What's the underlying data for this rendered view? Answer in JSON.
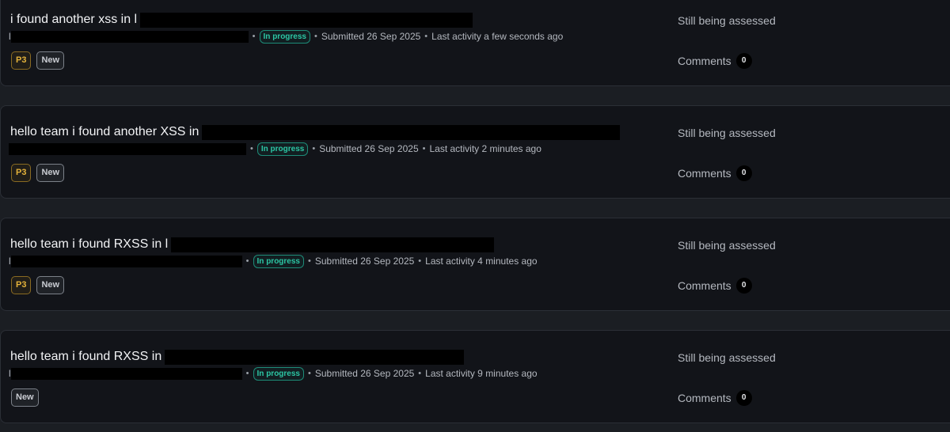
{
  "reports": [
    {
      "title": "i found another xss in l",
      "title_tail": "",
      "title_redact_width": 420,
      "meta_prefix": "l",
      "meta_redact_width": 300,
      "status": "In progress",
      "submitted": "Submitted 26 Sep 2025",
      "last_activity": "Last activity a few seconds ago",
      "priority": "P3",
      "state_tag": "New",
      "assessment": "Still being assessed",
      "comments_label": "Comments",
      "comments_count": "0"
    },
    {
      "title": "hello team i found another XSS in",
      "title_tail": "",
      "title_redact_width": 528,
      "meta_prefix": "",
      "meta_redact_width": 298,
      "status": "In progress",
      "submitted": "Submitted 26 Sep 2025",
      "last_activity": "Last activity 2 minutes ago",
      "priority": "P3",
      "state_tag": "New",
      "assessment": "Still being assessed",
      "comments_label": "Comments",
      "comments_count": "0"
    },
    {
      "title": "hello team i found RXSS in l",
      "title_tail": "",
      "title_redact_width": 408,
      "meta_prefix": "l",
      "meta_redact_width": 290,
      "status": "In progress",
      "submitted": "Submitted 26 Sep 2025",
      "last_activity": "Last activity 4 minutes ago",
      "priority": "P3",
      "state_tag": "New",
      "assessment": "Still being assessed",
      "comments_label": "Comments",
      "comments_count": "0"
    },
    {
      "title": "hello team i found RXSS in",
      "title_tail": "",
      "title_redact_width": 378,
      "meta_prefix": "l",
      "meta_redact_width": 290,
      "status": "In progress",
      "submitted": "Submitted 26 Sep 2025",
      "last_activity": "Last activity 9 minutes ago",
      "priority": null,
      "state_tag": "New",
      "assessment": "Still being assessed",
      "comments_label": "Comments",
      "comments_count": "0"
    }
  ]
}
